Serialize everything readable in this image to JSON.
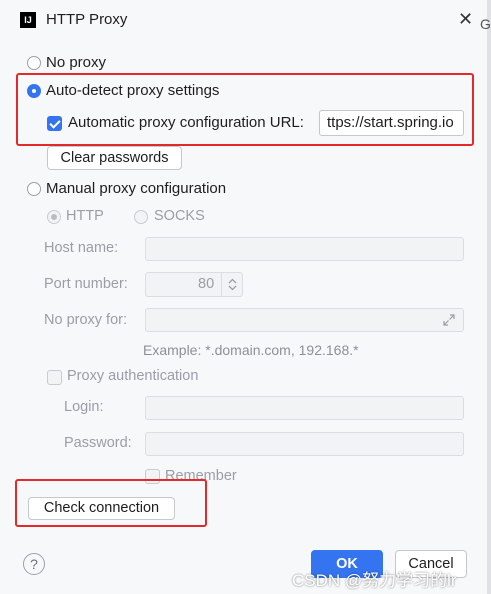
{
  "window": {
    "title": "HTTP Proxy",
    "app_icon_text": "IJ",
    "edge_letter": "G"
  },
  "proxy_options": {
    "no_proxy": "No proxy",
    "auto_detect": "Auto-detect proxy settings",
    "auto_config_url_label": "Automatic proxy configuration URL:",
    "auto_config_url_value": "ttps://start.spring.io",
    "clear_passwords": "Clear passwords",
    "manual": "Manual proxy configuration"
  },
  "manual": {
    "http": "HTTP",
    "socks": "SOCKS",
    "host_label": "Host name:",
    "port_label": "Port number:",
    "port_value": "80",
    "no_proxy_label": "No proxy for:",
    "example_hint": "Example: *.domain.com, 192.168.*",
    "auth_label": "Proxy authentication",
    "login_label": "Login:",
    "password_label": "Password:",
    "remember_label": "Remember"
  },
  "buttons": {
    "check_connection": "Check connection",
    "ok": "OK",
    "cancel": "Cancel",
    "help": "?"
  },
  "watermark": "CSDN @努力学习的lr",
  "colors": {
    "accent": "#3574f0",
    "highlight_box": "#e32a2a"
  }
}
